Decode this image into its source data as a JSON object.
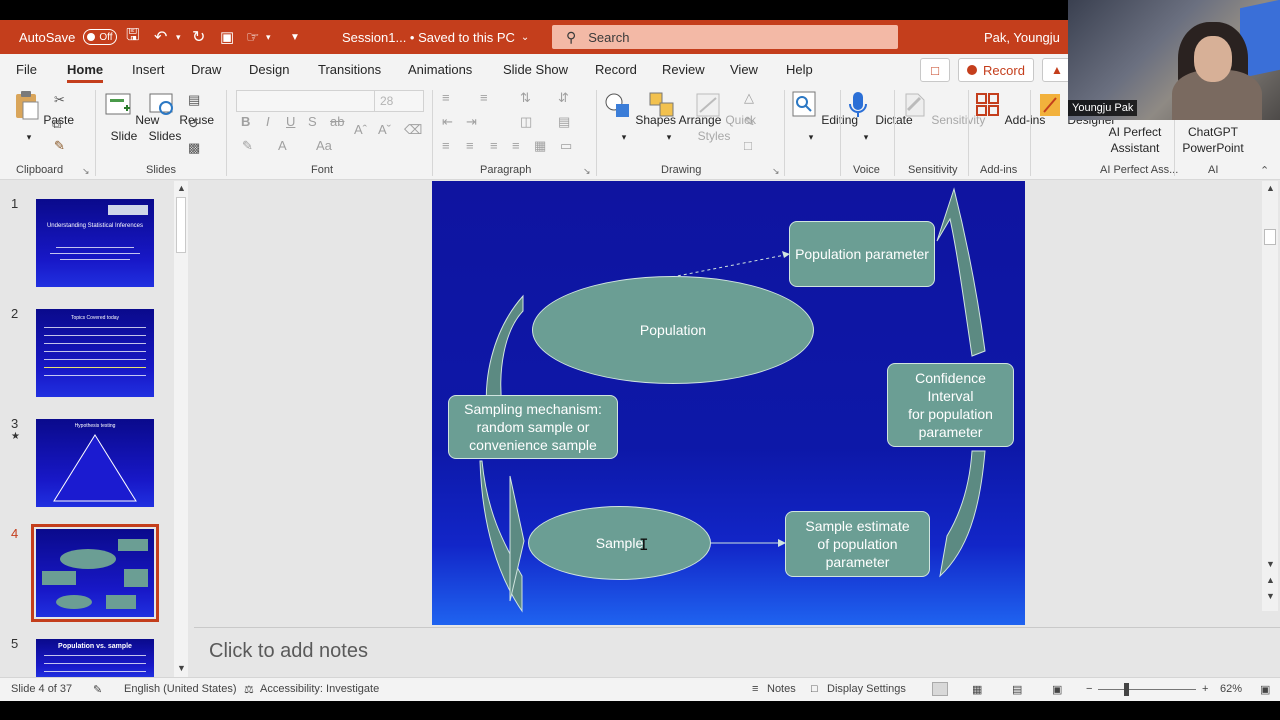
{
  "titlebar": {
    "autosave_label": "AutoSave",
    "autosave_state": "Off",
    "doc_title": "Session1... • Saved to this PC",
    "search_placeholder": "Search",
    "user_name": "Pak, Youngju"
  },
  "menu": {
    "tabs": [
      "File",
      "Home",
      "Insert",
      "Draw",
      "Design",
      "Transitions",
      "Animations",
      "Slide Show",
      "Record",
      "Review",
      "View",
      "Help"
    ],
    "active_tab": "Home",
    "record_button": "Record"
  },
  "ribbon": {
    "paste": "Paste",
    "new_slide": "New\nSlide",
    "reuse_slides": "Reuse\nSlides",
    "font_size": "28",
    "shapes": "Shapes",
    "arrange": "Arrange",
    "quick_styles": "Quick\nStyles",
    "editing": "Editing",
    "dictate": "Dictate",
    "sensitivity": "Sensitivity",
    "addins": "Add-ins",
    "designer": "Designer",
    "ai_perfect": "AI Perfect\nAssistant",
    "chatgpt": "ChatGPT\nPowerPoint",
    "groups": {
      "clipboard": "Clipboard",
      "slides": "Slides",
      "font": "Font",
      "paragraph": "Paragraph",
      "drawing": "Drawing",
      "voice": "Voice",
      "sensitivity": "Sensitivity",
      "addins": "Add-ins",
      "ai_perfect": "AI Perfect Ass...",
      "ai": "AI"
    }
  },
  "thumbnails": [
    {
      "num": "1",
      "title": "Understanding Statistical Inferences"
    },
    {
      "num": "2",
      "title": "Topics Covered today"
    },
    {
      "num": "3",
      "title": "Hypothesis testing",
      "star": "★"
    },
    {
      "num": "4",
      "title": ""
    },
    {
      "num": "5",
      "title": "Population vs. sample"
    }
  ],
  "slide": {
    "population_parameter": "Population parameter",
    "population": "Population",
    "sampling_mechanism": "Sampling mechanism:\nrandom sample or\nconvenience sample",
    "confidence_interval": "Confidence\nInterval\nfor population\nparameter",
    "sample": "Sample",
    "sample_estimate": "Sample estimate\nof population\nparameter"
  },
  "notes": {
    "placeholder": "Click to add notes"
  },
  "status": {
    "slide_count": "Slide 4 of 37",
    "language": "English (United States)",
    "accessibility": "Accessibility: Investigate",
    "notes": "Notes",
    "display_settings": "Display Settings",
    "zoom": "62%"
  },
  "webcam": {
    "name": "Youngju Pak"
  },
  "colors": {
    "accent": "#c43e1c",
    "shape_fill": "#6b9e94",
    "slide_bg": "#0f14a0"
  }
}
